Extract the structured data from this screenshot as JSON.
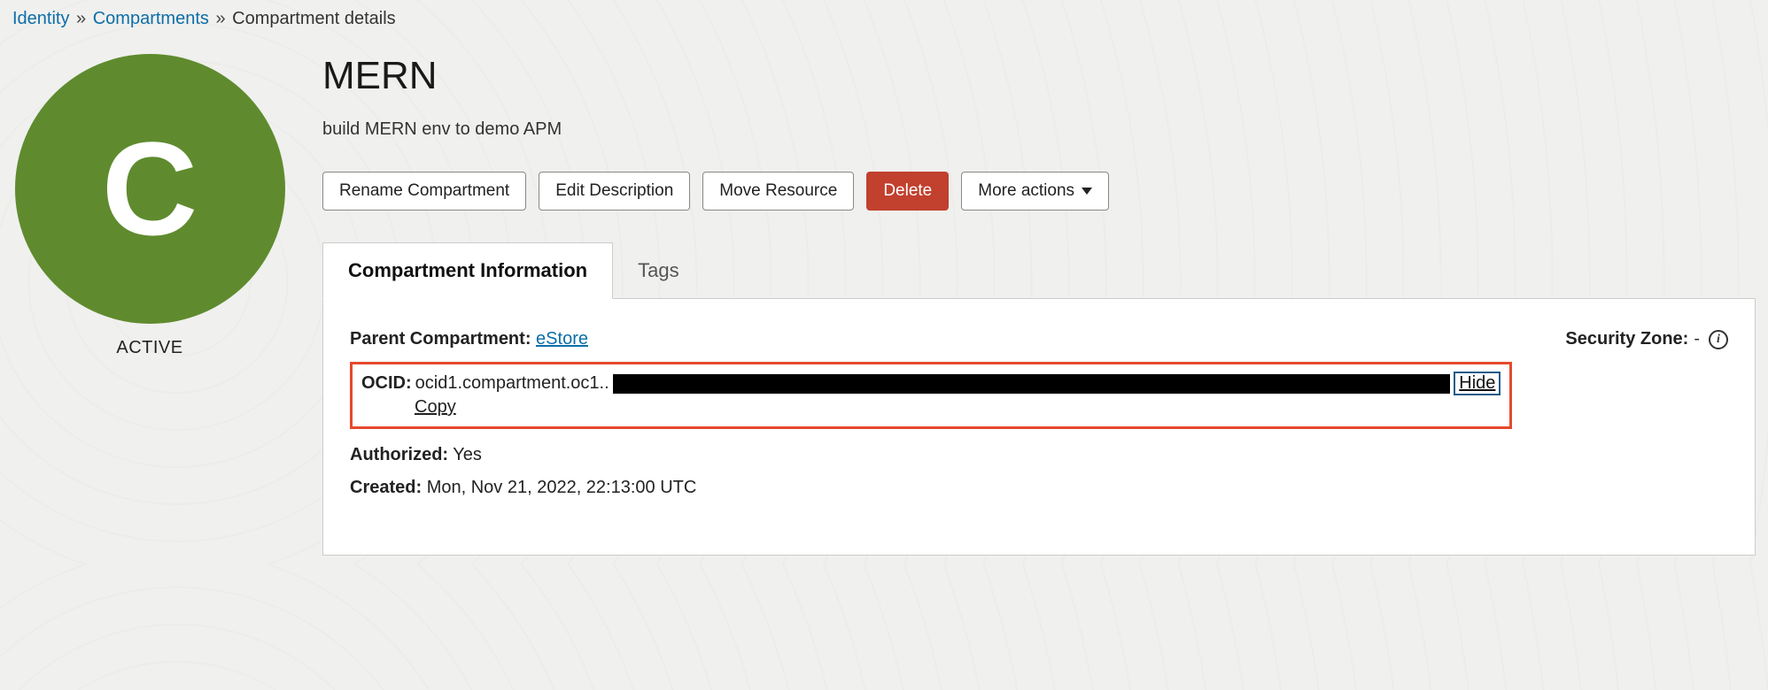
{
  "breadcrumb": {
    "identity": "Identity",
    "compartments": "Compartments",
    "details": "Compartment details"
  },
  "badge": {
    "letter": "C",
    "status": "ACTIVE"
  },
  "header": {
    "title": "MERN",
    "description": "build MERN env to demo APM"
  },
  "buttons": {
    "rename": "Rename Compartment",
    "edit": "Edit Description",
    "move": "Move Resource",
    "delete": "Delete",
    "more": "More actions"
  },
  "tabs": {
    "info": "Compartment Information",
    "tags": "Tags"
  },
  "info": {
    "parent_label": "Parent Compartment:",
    "parent_value": "eStore",
    "ocid_label": "OCID:",
    "ocid_prefix": "ocid1.compartment.oc1..",
    "hide": "Hide",
    "copy": "Copy",
    "authorized_label": "Authorized:",
    "authorized_value": "Yes",
    "created_label": "Created:",
    "created_value": "Mon, Nov 21, 2022, 22:13:00 UTC",
    "security_label": "Security Zone:",
    "security_value": "-"
  }
}
